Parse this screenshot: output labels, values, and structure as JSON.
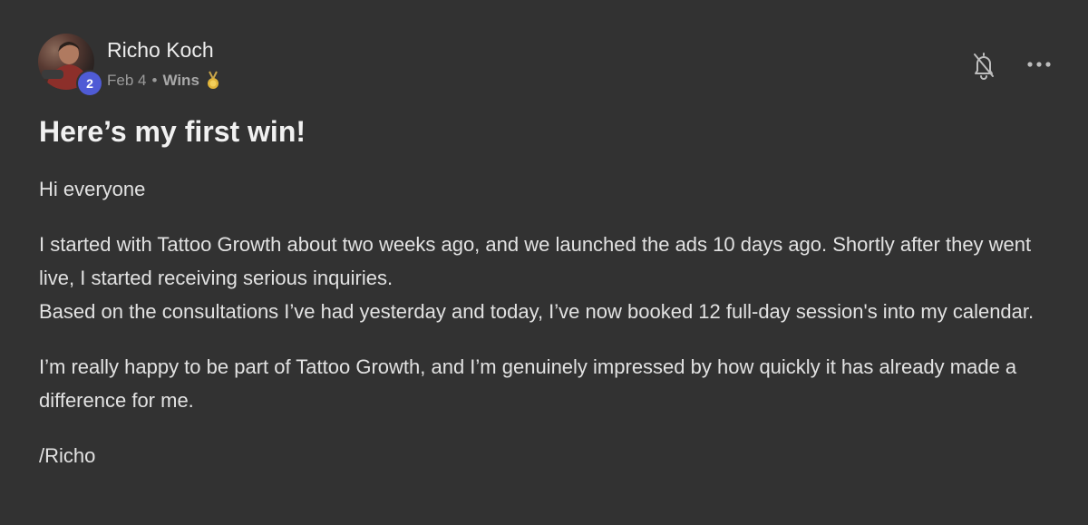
{
  "post": {
    "author": {
      "name": "Richo Koch",
      "level": "2"
    },
    "meta": {
      "date": "Feb 4",
      "separator": "•",
      "category": "Wins"
    },
    "title": "Here’s my first win!",
    "body": {
      "greeting": "Hi everyone",
      "para1_line1": "I started with Tattoo Growth about two weeks ago, and we launched the ads 10 days ago. Shortly after they went live, I started receiving serious inquiries.",
      "para1_line2": "Based on the consultations I’ve had yesterday and today, I’ve now booked 12 full-day session's into my calendar.",
      "para2": "I’m really happy to be part of Tattoo Growth, and I’m genuinely impressed by how quickly it has already made a difference for me.",
      "signature": "/Richo"
    },
    "icons": {
      "bell": "bell-off-icon",
      "more": "more-horizontal-icon",
      "medal": "medal-icon"
    },
    "colors": {
      "background": "#323232",
      "badge": "#4f5bd5",
      "medal": "#e0b43a"
    }
  }
}
